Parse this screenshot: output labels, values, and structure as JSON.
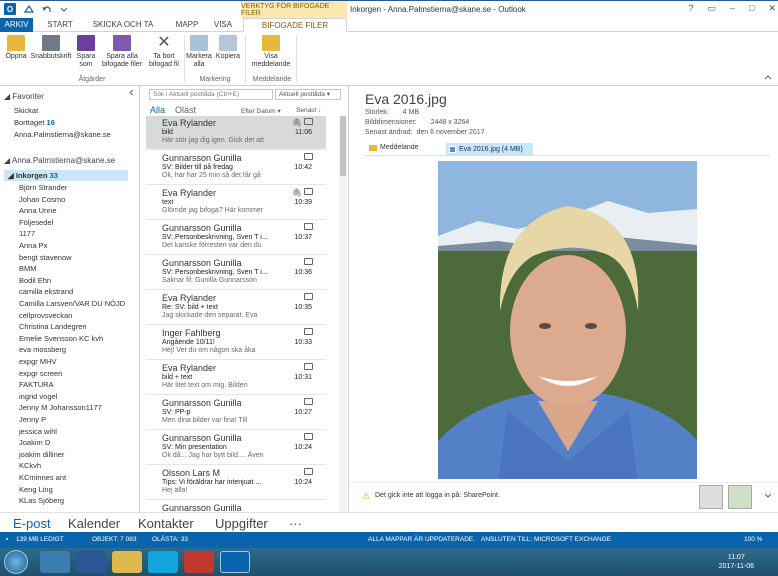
{
  "window": {
    "title": "Inkorgen - Anna.Palmstierna@skane.se - Outlook",
    "context_tab": "VERKTYG FÖR BIFOGADE FILER",
    "app_icon": "O"
  },
  "tabs": [
    {
      "label": "ARKIV"
    },
    {
      "label": "START"
    },
    {
      "label": "SKICKA OCH TA EMOT"
    },
    {
      "label": "MAPP"
    },
    {
      "label": "VISA"
    },
    {
      "label": "BIFOGADE FILER"
    }
  ],
  "ribbon": {
    "buttons": {
      "open": "Öppna",
      "quickprint": "Snabbutskrift",
      "save_as": "Spara som",
      "save_all": "Spara alla bifogade filer",
      "remove": "Ta bort bifogad fil",
      "select_all": "Markera alla",
      "copy": "Kopiera",
      "show_message": "Visa meddelande"
    },
    "groups": {
      "actions": "Åtgärder",
      "selection": "Markering",
      "message": "Meddelande"
    }
  },
  "folders": {
    "favorites_header": "Favoriter",
    "favorites": [
      {
        "label": "Skickat",
        "count": ""
      },
      {
        "label": "Borttaget",
        "count": "16"
      },
      {
        "label": "Anna.Palmstierna@skane.se",
        "count": ""
      }
    ],
    "account": "Anna.Palmstierna@skane.se",
    "inbox": {
      "label": "Inkorgen",
      "count": "33"
    },
    "subfolders": [
      "Björn Strander",
      "Johan Cosmo",
      "Anna Unne",
      "Följesedel",
      "1177",
      "Anna Px",
      "bengt stavenow",
      "BMM",
      "Bodil Ehn",
      "camilla ekstrand",
      "Camilla Larsven/VAR DU NÖJD",
      "cellprovsveckan",
      "Christina Landegren",
      "Emelie Svensson KC kvh",
      "eva mossberg",
      "expgr MHV",
      "expgr screen",
      "FAKTURA",
      "ingrid vogel",
      "Jenny M Johansson1177",
      "Jenny P",
      "jessica wihl",
      "Joakim D",
      "joakim dilliner",
      "KCkvh",
      "KCminnes ant",
      "Keng Ling",
      "KLas Sjöberg"
    ]
  },
  "message_list": {
    "search_placeholder": "Sök i Aktuell postlåda (Ctrl+E)",
    "search_scope": "Aktuell postlåda",
    "filter_all": "Alla",
    "filter_unread": "Oläst",
    "sort_by": "Efter Datum",
    "sort_order": "Senast",
    "items": [
      {
        "from": "Eva Rylander",
        "subject": "bild",
        "preview": "Här stör jag dig igen. Gick det att",
        "time": "11:06",
        "attachment": true,
        "selected": true
      },
      {
        "from": "Gunnarsson Gunilla",
        "subject": "SV: Bilder till på fredag",
        "preview": "Ok, har har 25 min så det får gå",
        "time": "10:42",
        "attachment": false
      },
      {
        "from": "Eva Rylander",
        "subject": "text",
        "preview": "Glömde jag bifoga? Här kommer",
        "time": "10:39",
        "attachment": true
      },
      {
        "from": "Gunnarsson Gunilla",
        "subject": "SV: Personbeskrivning, Sven T i...",
        "preview": "Det kanske förresten var den du",
        "time": "10:37",
        "attachment": false
      },
      {
        "from": "Gunnarsson Gunilla",
        "subject": "SV: Personbeskrivning, Sven T i...",
        "preview": "Saknar fil: Gunilla Gunnarsson",
        "time": "10:36",
        "attachment": false
      },
      {
        "from": "Eva Rylander",
        "subject": "Re: SV: bild + text",
        "preview": "Jag skickade den separat.  Eva",
        "time": "10:35",
        "attachment": false
      },
      {
        "from": "Inger Fahlberg",
        "subject": "Angående 10/11!",
        "preview": "Hej!  Vet du om någon ska åka",
        "time": "10:33",
        "attachment": false
      },
      {
        "from": "Eva Rylander",
        "subject": "bild + text",
        "preview": "Här litet text om mig. Bilden",
        "time": "10:31",
        "attachment": false
      },
      {
        "from": "Gunnarsson Gunilla",
        "subject": "SV: PP-p",
        "preview": "Men dina bilder var fina! Till",
        "time": "10:27",
        "attachment": false
      },
      {
        "from": "Gunnarsson Gunilla",
        "subject": "SV: Min presentation",
        "preview": "Ok då... Jag har bytt bild.... Även",
        "time": "10:24",
        "attachment": false
      },
      {
        "from": "Olsson Lars M",
        "subject": "Tips: Vi föräldrar har intenjuat ...",
        "preview": "Hej alla!",
        "time": "10:24",
        "attachment": false
      },
      {
        "from": "Gunnarsson Gunilla",
        "subject": "",
        "preview": "",
        "time": "",
        "attachment": false
      }
    ]
  },
  "reading_pane": {
    "attachment_title": "Eva 2016.jpg",
    "size_label": "Storlek:",
    "size_value": "4 MB",
    "dims_label": "Bilddimensioner:",
    "dims_value": "2448 x 3264",
    "modified_label": "Senast ändrad:",
    "modified_value": "den 6 november 2017",
    "tab_message": "Meddelande",
    "tab_file": "Eva 2016.jpg (4 MB)",
    "sharepoint_notice": "Det gick inte att logga in på: SharePoint."
  },
  "nav": {
    "mail": "E-post",
    "calendar": "Kalender",
    "contacts": "Kontakter",
    "tasks": "Uppgifter",
    "more": "···"
  },
  "status": {
    "free": "139 MB LEDIGT",
    "items": "OBJEKT: 7 083",
    "unread": "OLÄSTA: 33",
    "folders": "ALLA MAPPAR ÄR UPPDATERADE.",
    "connected": "ANSLUTEN TILL: MICROSOFT EXCHANGE",
    "zoom": "100 %"
  },
  "taskbar": {
    "time": "11:07",
    "date": "2017-11-06"
  },
  "colors": {
    "accent": "#0a64ad",
    "context_tab": "#fbe8b0",
    "selected_row": "#d9d9d9"
  }
}
